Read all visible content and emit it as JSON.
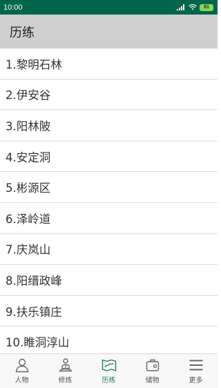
{
  "status_bar": {
    "time": "10:00",
    "battery": "81"
  },
  "header": {
    "title": "历练"
  },
  "list": {
    "items": [
      {
        "label": "1.黎明石林"
      },
      {
        "label": "2.伊安谷"
      },
      {
        "label": "3.阳林陂"
      },
      {
        "label": "4.安定洞"
      },
      {
        "label": "5.彬源区"
      },
      {
        "label": "6.泽岭道"
      },
      {
        "label": "7.庆岚山"
      },
      {
        "label": "8.阳缙政峰"
      },
      {
        "label": "9.扶乐镇庄"
      },
      {
        "label": "10.睢洞淳山"
      }
    ]
  },
  "tabs": [
    {
      "label": "人物",
      "icon": "person-icon"
    },
    {
      "label": "修炼",
      "icon": "meditate-icon"
    },
    {
      "label": "历练",
      "icon": "map-icon",
      "active": true
    },
    {
      "label": "储物",
      "icon": "bag-icon"
    },
    {
      "label": "更多",
      "icon": "menu-icon"
    }
  ],
  "colors": {
    "status_bar": "#00664a",
    "header": "#cfcfcf",
    "accent": "#1d7a5a"
  }
}
